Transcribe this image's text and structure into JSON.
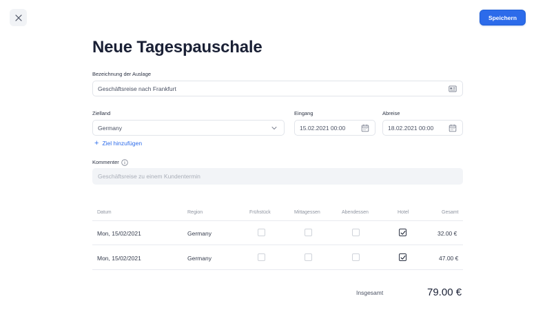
{
  "header": {
    "save_label": "Speichern",
    "title": "Neue Tagespauschale"
  },
  "form": {
    "description_label": "Bezeichnung der Auslage",
    "description_value": "Geschäftsreise nach Frankfurt",
    "country_label": "Zielland",
    "country_value": "Germany",
    "arrival_label": "Eingang",
    "arrival_value": "15.02.2021 00:00",
    "departure_label": "Abreise",
    "departure_value": "18.02.2021 00:00",
    "add_destination": "Ziel hinzufügen",
    "comment_label": "Kommenter",
    "comment_placeholder": "Geschäftsreise zu einem Kundentermin"
  },
  "table": {
    "headers": {
      "date": "Datum",
      "region": "Region",
      "breakfast": "Frühstück",
      "lunch": "Mittagessen",
      "dinner": "Abendessen",
      "hotel": "Hotel",
      "total": "Gesamt"
    },
    "rows": [
      {
        "date": "Mon, 15/02/2021",
        "region": "Germany",
        "breakfast": false,
        "lunch": false,
        "dinner": false,
        "hotel": true,
        "total": "32.00 €"
      },
      {
        "date": "Mon, 15/02/2021",
        "region": "Germany",
        "breakfast": false,
        "lunch": false,
        "dinner": false,
        "hotel": true,
        "total": "47.00 €"
      }
    ]
  },
  "summary": {
    "label": "Insgesamt",
    "value": "79.00 €"
  }
}
